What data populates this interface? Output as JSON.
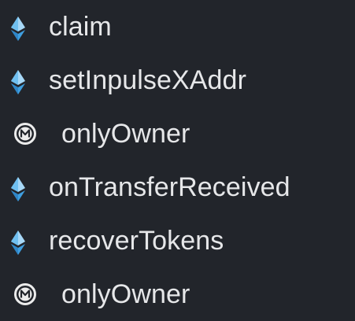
{
  "outline": {
    "items": [
      {
        "kind": "function",
        "icon": "ethereum-diamond-icon",
        "label": "claim"
      },
      {
        "kind": "function",
        "icon": "ethereum-diamond-icon",
        "label": "setInpulseXAddr"
      },
      {
        "kind": "modifier",
        "icon": "circled-m-icon",
        "label": "onlyOwner"
      },
      {
        "kind": "function",
        "icon": "ethereum-diamond-icon",
        "label": "onTransferReceived"
      },
      {
        "kind": "function",
        "icon": "ethereum-diamond-icon",
        "label": "recoverTokens"
      },
      {
        "kind": "modifier",
        "icon": "circled-m-icon",
        "label": "onlyOwner"
      }
    ]
  },
  "colors": {
    "background": "#22252b",
    "text": "#e6e7e9",
    "diamond_light": "#a7d8f7",
    "diamond_dark": "#3f9fe0",
    "modifier_icon": "#ececec"
  }
}
